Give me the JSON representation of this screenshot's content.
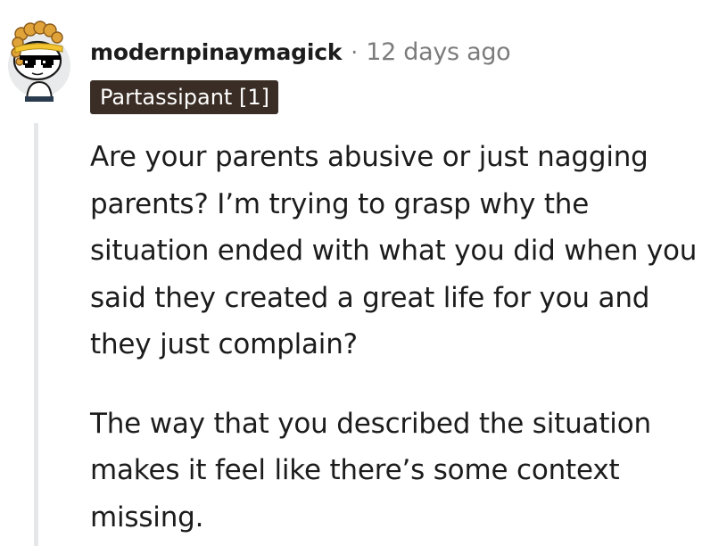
{
  "comment": {
    "username": "modernpinaymagick",
    "separator": "·",
    "timestamp": "12 days ago",
    "flair": "Partassipant [1]",
    "paragraphs": [
      "Are your parents abusive or just nagging parents? I’m trying to grasp why the situation ended with what you did when you said they created a great life for you and they just complain?",
      "The way that you described the situation makes it feel like there’s some context missing."
    ]
  },
  "avatar": {
    "icon": "snoo-avatar-icon",
    "colors": {
      "background": "#e9eaeb",
      "hair": "#e0a339",
      "headband": "#f4c430",
      "sunglasses": "#000000",
      "skin": "#ffffff"
    }
  },
  "colors": {
    "flair_bg": "#3a2d25",
    "meta_text": "#7c7c7c",
    "thread_line": "#e5e7e9"
  }
}
